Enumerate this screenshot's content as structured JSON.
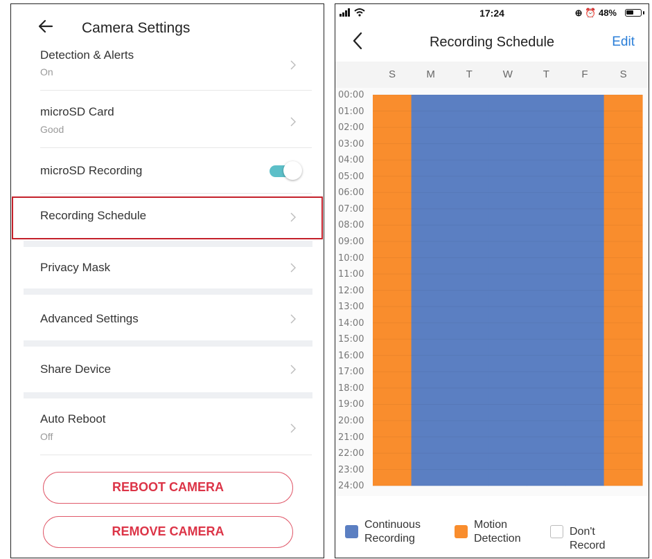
{
  "left": {
    "title": "Camera Settings",
    "rows": [
      {
        "title": "Detection & Alerts",
        "subtitle": "On"
      },
      {
        "title": "microSD Card",
        "subtitle": "Good"
      },
      {
        "title": "microSD Recording"
      },
      {
        "title": "Recording Schedule"
      },
      {
        "title": "Privacy Mask"
      },
      {
        "title": "Advanced Settings"
      },
      {
        "title": "Share Device"
      },
      {
        "title": "Auto Reboot",
        "subtitle": "Off"
      }
    ],
    "toggle_on": true,
    "reboot_label": "REBOOT CAMERA",
    "remove_label": "REMOVE CAMERA",
    "accent_color": "#dc3447",
    "highlight_color": "#c4202a"
  },
  "right": {
    "status": {
      "time": "17:24",
      "battery": "48%",
      "battery_level": 0.48
    },
    "title": "Recording Schedule",
    "edit_label": "Edit",
    "days": [
      "S",
      "M",
      "T",
      "W",
      "T",
      "F",
      "S"
    ],
    "hours": [
      "00:00",
      "01:00",
      "02:00",
      "03:00",
      "04:00",
      "05:00",
      "06:00",
      "07:00",
      "08:00",
      "09:00",
      "10:00",
      "11:00",
      "12:00",
      "13:00",
      "14:00",
      "15:00",
      "16:00",
      "17:00",
      "18:00",
      "19:00",
      "20:00",
      "21:00",
      "22:00",
      "23:00",
      "24:00"
    ],
    "schedule": [
      "motion",
      "continuous",
      "continuous",
      "continuous",
      "continuous",
      "continuous",
      "motion"
    ],
    "legend": [
      {
        "key": "continuous",
        "label": "Continuous\nRecording",
        "color": "#5b7fc2"
      },
      {
        "key": "motion",
        "label": "Motion\nDetection",
        "color": "#f98d2d"
      },
      {
        "key": "none",
        "label": "Don't Record",
        "color": "#ffffff"
      }
    ]
  }
}
